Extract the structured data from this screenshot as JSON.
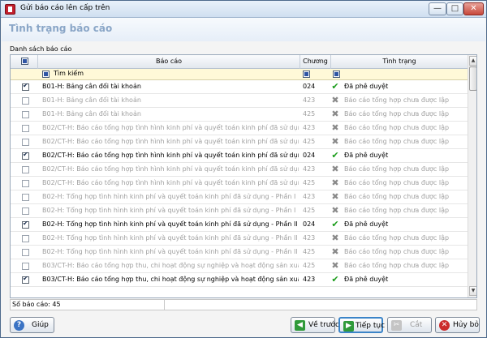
{
  "window": {
    "title": "Gửi báo cáo lên cấp trên",
    "min_glyph": "—",
    "max_glyph": "□",
    "close_glyph": "✕"
  },
  "page_title": "Tình trạng báo cáo",
  "section_label": "Danh sách báo cáo",
  "table": {
    "columns": [
      "Báo cáo",
      "Chương",
      "Tình trạng"
    ],
    "filter_label": "Tìm kiếm",
    "rows": [
      {
        "checked": true,
        "enabled": true,
        "report": "B01-H: Bảng cân đối tài khoản",
        "chuong": "024",
        "status": "Đã phê duyệt",
        "status_icon": "check-icon"
      },
      {
        "checked": false,
        "enabled": false,
        "report": "B01-H: Bảng cân đối tài khoản",
        "chuong": "423",
        "status": "Báo cáo tổng hợp chưa được lập",
        "status_icon": "cross-icon"
      },
      {
        "checked": false,
        "enabled": false,
        "report": "B01-H: Bảng cân đối tài khoản",
        "chuong": "425",
        "status": "Báo cáo tổng hợp chưa được lập",
        "status_icon": "cross-icon"
      },
      {
        "checked": false,
        "enabled": false,
        "report": "B02/CT-H: Báo cáo tổng hợp tình hình kinh phí và quyết toán kinh phí đã sử dụng - P",
        "chuong": "423",
        "status": "Báo cáo tổng hợp chưa được lập",
        "status_icon": "cross-icon"
      },
      {
        "checked": false,
        "enabled": false,
        "report": "B02/CT-H: Báo cáo tổng hợp tình hình kinh phí và quyết toán kinh phí đã sử dụng - P",
        "chuong": "425",
        "status": "Báo cáo tổng hợp chưa được lập",
        "status_icon": "cross-icon"
      },
      {
        "checked": true,
        "enabled": true,
        "report": "B02/CT-H: Báo cáo tổng hợp tình hình kinh phí và quyết toán kinh phí đã sử dụng - P",
        "chuong": "024",
        "status": "Đã phê duyệt",
        "status_icon": "check-icon"
      },
      {
        "checked": false,
        "enabled": false,
        "report": "B02/CT-H: Báo cáo tổng hợp tình hình kinh phí và quyết toán kinh phí đã sử dụng - P",
        "chuong": "423",
        "status": "Báo cáo tổng hợp chưa được lập",
        "status_icon": "cross-icon"
      },
      {
        "checked": false,
        "enabled": false,
        "report": "B02/CT-H: Báo cáo tổng hợp tình hình kinh phí và quyết toán kinh phí đã sử dụng - P",
        "chuong": "425",
        "status": "Báo cáo tổng hợp chưa được lập",
        "status_icon": "cross-icon"
      },
      {
        "checked": false,
        "enabled": false,
        "report": "B02-H: Tổng hợp tình hình kinh phí và quyết toán kinh phí đã sử dụng - Phần I",
        "chuong": "423",
        "status": "Báo cáo tổng hợp chưa được lập",
        "status_icon": "cross-icon"
      },
      {
        "checked": false,
        "enabled": false,
        "report": "B02-H: Tổng hợp tình hình kinh phí và quyết toán kinh phí đã sử dụng - Phần I",
        "chuong": "425",
        "status": "Báo cáo tổng hợp chưa được lập",
        "status_icon": "cross-icon"
      },
      {
        "checked": true,
        "enabled": true,
        "report": "B02-H: Tổng hợp tình hình kinh phí và quyết toán kinh phí đã sử dụng - Phần II",
        "chuong": "024",
        "status": "Đã phê duyệt",
        "status_icon": "check-icon"
      },
      {
        "checked": false,
        "enabled": false,
        "report": "B02-H: Tổng hợp tình hình kinh phí và quyết toán kinh phí đã sử dụng - Phần II",
        "chuong": "423",
        "status": "Báo cáo tổng hợp chưa được lập",
        "status_icon": "cross-icon"
      },
      {
        "checked": false,
        "enabled": false,
        "report": "B02-H: Tổng hợp tình hình kinh phí và quyết toán kinh phí đã sử dụng - Phần II",
        "chuong": "425",
        "status": "Báo cáo tổng hợp chưa được lập",
        "status_icon": "cross-icon"
      },
      {
        "checked": false,
        "enabled": false,
        "report": "B03/CT-H: Báo cáo tổng hợp thu, chi hoạt động sự nghiệp và hoạt động sản xuất kin",
        "chuong": "425",
        "status": "Báo cáo tổng hợp chưa được lập",
        "status_icon": "cross-icon"
      },
      {
        "checked": true,
        "enabled": true,
        "report": "B03/CT-H: Báo cáo tổng hợp thu, chi hoạt động sự nghiệp và hoạt động sản xuất kin",
        "chuong": "423",
        "status": "Đã phê duyệt",
        "status_icon": "check-icon"
      }
    ]
  },
  "footer": {
    "count_text": "Số báo cáo: 45"
  },
  "buttons": {
    "help": "Giúp",
    "back": "Về trước",
    "next": "Tiếp tục",
    "cut": "Cắt",
    "cancel": "Hủy bỏ"
  },
  "icons": {
    "check": "✔",
    "cross": "✖",
    "help": "?",
    "back": "◀",
    "next": "▶",
    "cut": "✂",
    "cancel": "✕",
    "scroll_up": "▲",
    "scroll_down": "▼"
  },
  "colors": {
    "title_accent": "#8aa6c7",
    "filter_bg": "#fff9d8",
    "approved": "#1a9c1a",
    "disabled_text": "#a0a0a0"
  }
}
